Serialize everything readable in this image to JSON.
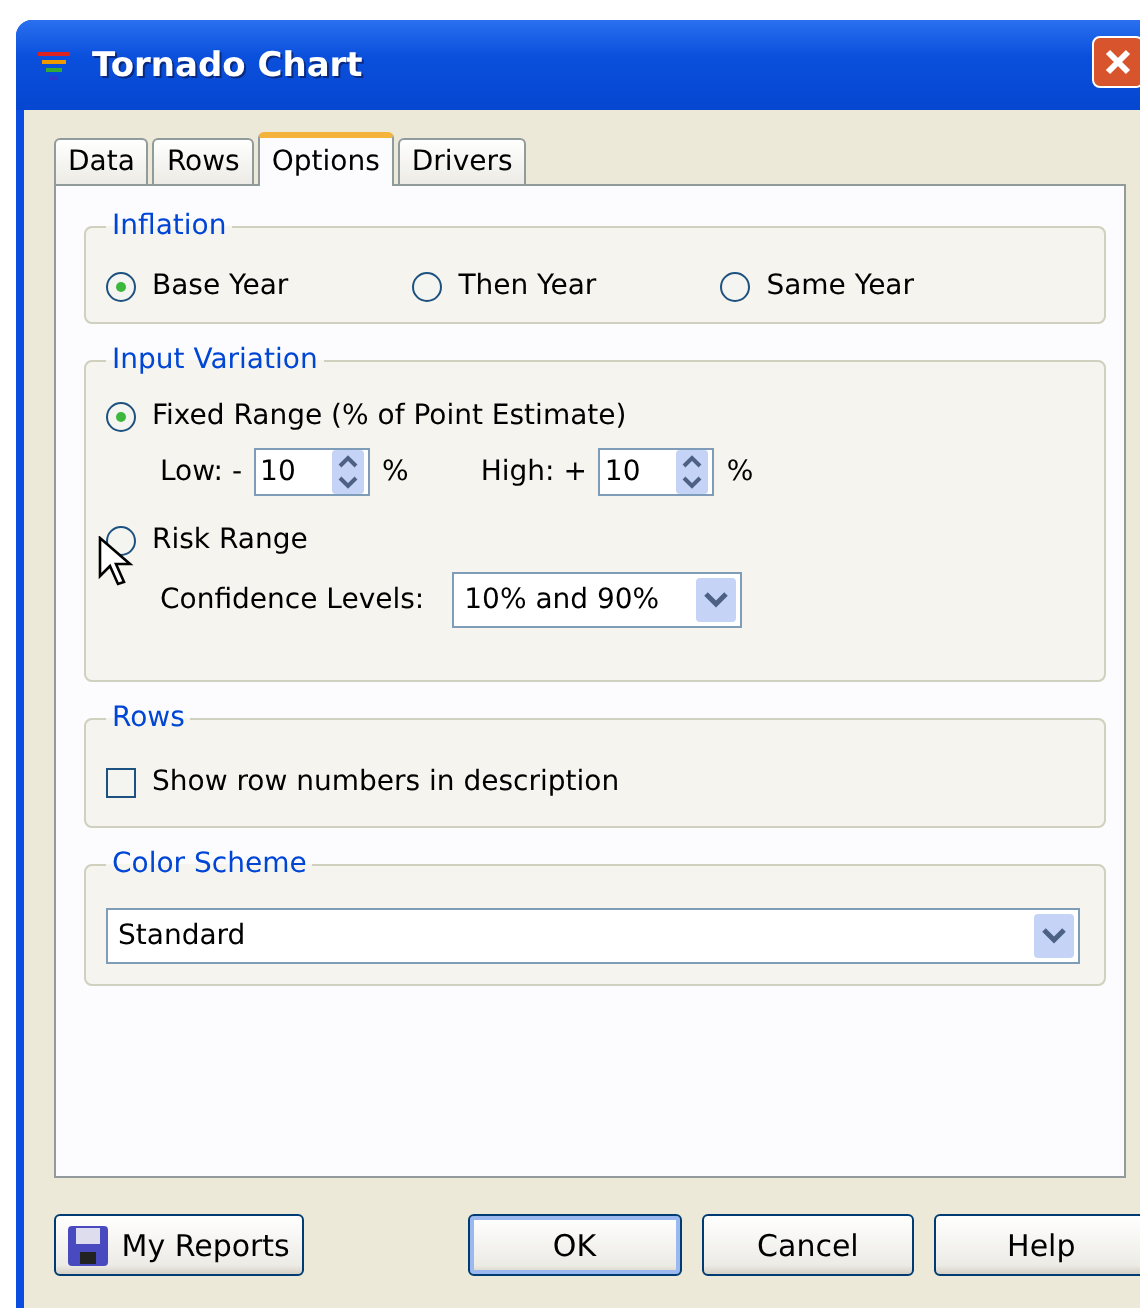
{
  "window": {
    "title": "Tornado Chart"
  },
  "tabs": [
    {
      "label": "Data",
      "selected": false
    },
    {
      "label": "Rows",
      "selected": false
    },
    {
      "label": "Options",
      "selected": true
    },
    {
      "label": "Drivers",
      "selected": false
    }
  ],
  "inflation": {
    "title": "Inflation",
    "options": [
      {
        "label": "Base Year",
        "selected": true
      },
      {
        "label": "Then Year",
        "selected": false
      },
      {
        "label": "Same Year",
        "selected": false
      }
    ]
  },
  "input_variation": {
    "title": "Input Variation",
    "modes": [
      {
        "label": "Fixed Range (% of Point Estimate)",
        "selected": true
      },
      {
        "label": "Risk Range",
        "selected": false
      }
    ],
    "low": {
      "label": "Low: -",
      "value": "10",
      "unit": "%"
    },
    "high": {
      "label": "High: +",
      "value": "10",
      "unit": "%"
    },
    "confidence": {
      "label": "Confidence Levels:",
      "value": "10% and 90%"
    }
  },
  "rows": {
    "title": "Rows",
    "checkbox": {
      "label": "Show row numbers in description",
      "checked": false
    }
  },
  "color_scheme": {
    "title": "Color Scheme",
    "value": "Standard"
  },
  "buttons": [
    {
      "label": "My Reports",
      "kind": "reports"
    },
    {
      "label": "OK",
      "kind": "default"
    },
    {
      "label": "Cancel",
      "kind": "normal"
    },
    {
      "label": "Help",
      "kind": "normal"
    }
  ]
}
